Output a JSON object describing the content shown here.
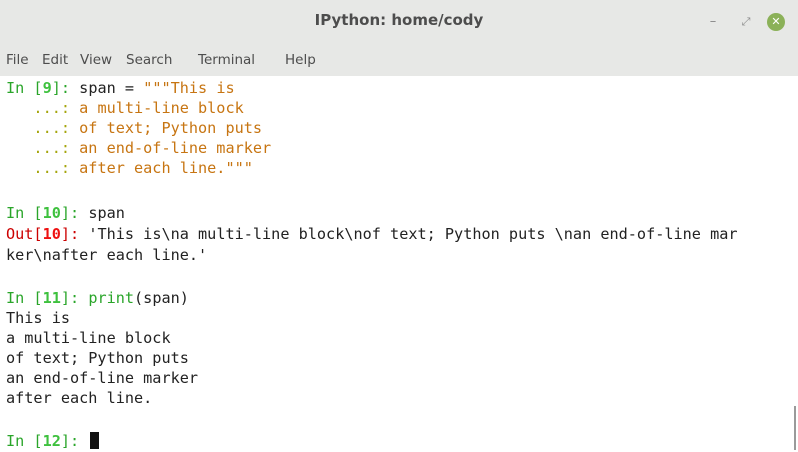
{
  "window": {
    "title": "IPython: home/cody",
    "minimize_glyph": "–",
    "maximize_glyph": "⤢",
    "close_glyph": "✕"
  },
  "menu": {
    "items": [
      "File",
      "Edit",
      "View",
      "Search",
      "Terminal",
      "Help"
    ]
  },
  "terminal": {
    "in9": {
      "prompt_in": "In [",
      "num": "9",
      "prompt_close": "]: ",
      "code": "span = ",
      "str": "\"\"\"This is"
    },
    "cont": {
      "prompt": "   ...: ",
      "lines": [
        "a multi-line block",
        "of text; Python puts",
        "an end-of-line marker",
        "after each line.\"\"\""
      ]
    },
    "in10": {
      "prompt_in": "In [",
      "num": "10",
      "prompt_close": "]: ",
      "code": "span"
    },
    "out10": {
      "prompt_out": "Out[",
      "num": "10",
      "prompt_close": "]: ",
      "line1": "'This is\\na multi-line block\\nof text; Python puts \\nan end-of-line mar",
      "line2": "ker\\nafter each line.'"
    },
    "in11": {
      "prompt_in": "In [",
      "num": "11",
      "prompt_close": "]: ",
      "func": "print",
      "args": "(span)"
    },
    "print_output": [
      "This is",
      "a multi-line block",
      "of text; Python puts",
      "an end-of-line marker",
      "after each line."
    ],
    "in12": {
      "prompt_in": "In [",
      "num": "12",
      "prompt_close": "]: "
    }
  },
  "colors": {
    "prompt_in": "#2aa52a",
    "prompt_out": "#cc0000",
    "string": "#c77512",
    "continuation": "#a5a50c",
    "titlebar": "#e7e8e6",
    "close_button": "#8bb158"
  }
}
